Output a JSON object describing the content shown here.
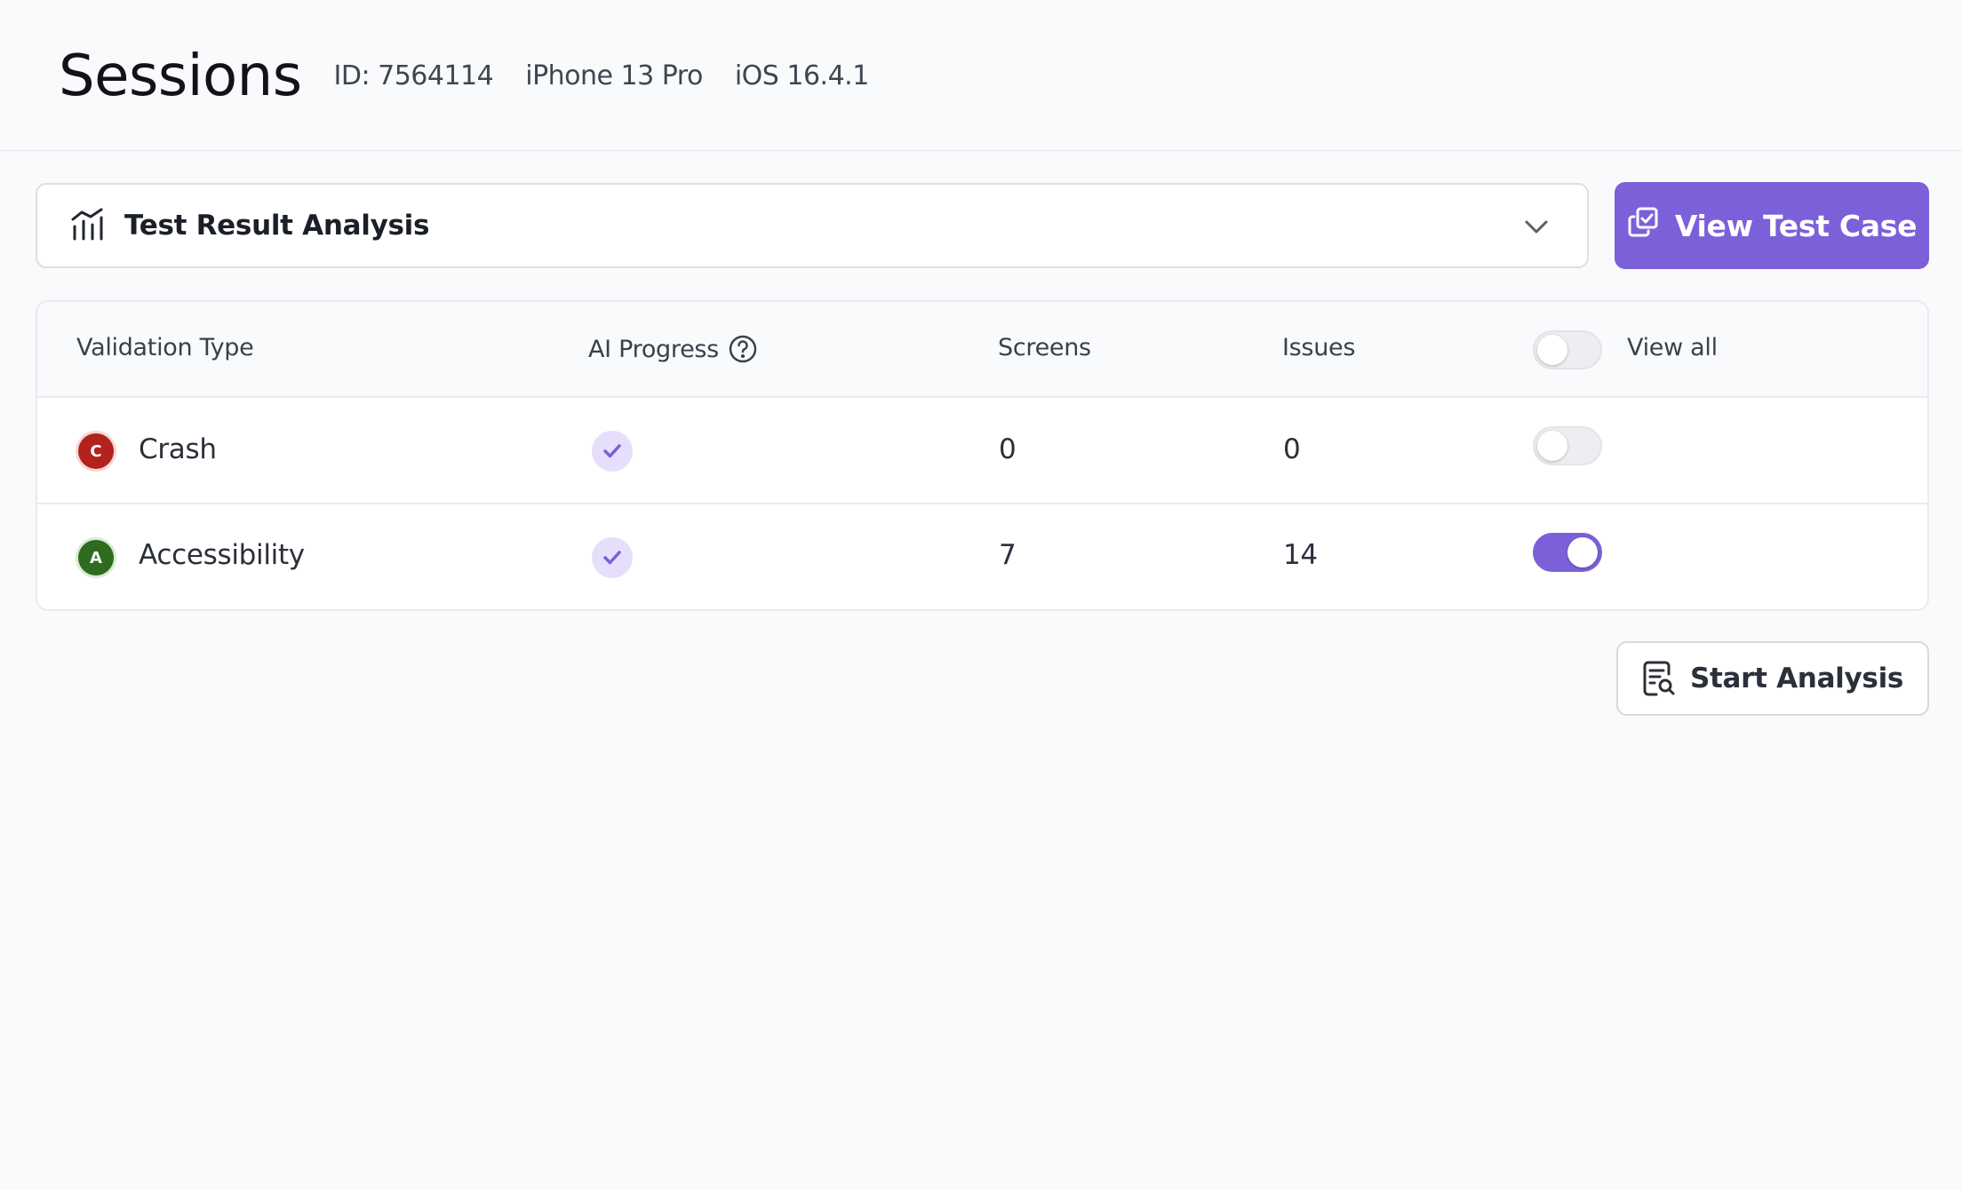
{
  "header": {
    "title": "Sessions",
    "session_id": "ID: 7564114",
    "device": "iPhone 13 Pro",
    "os": "iOS 16.4.1"
  },
  "analysis_select": {
    "selected": "Test Result Analysis",
    "icon": "analysis-chart-icon"
  },
  "actions": {
    "view_test_case": "View Test Case",
    "start_analysis": "Start Analysis"
  },
  "table": {
    "columns": {
      "validation_type": "Validation Type",
      "ai_progress": "AI Progress",
      "screens": "Screens",
      "issues": "Issues",
      "view_all": "View all"
    },
    "view_all_enabled": false,
    "rows": [
      {
        "badge": "C",
        "badge_color": "#b3221c",
        "type": "Crash",
        "ai_complete": true,
        "screens": "0",
        "issues": "0",
        "enabled": false
      },
      {
        "badge": "A",
        "badge_color": "#2f6b1f",
        "type": "Accessibility",
        "ai_complete": true,
        "screens": "7",
        "issues": "14",
        "enabled": true
      }
    ]
  },
  "colors": {
    "accent": "#7c60d9",
    "check_bg": "#e6dffb"
  }
}
